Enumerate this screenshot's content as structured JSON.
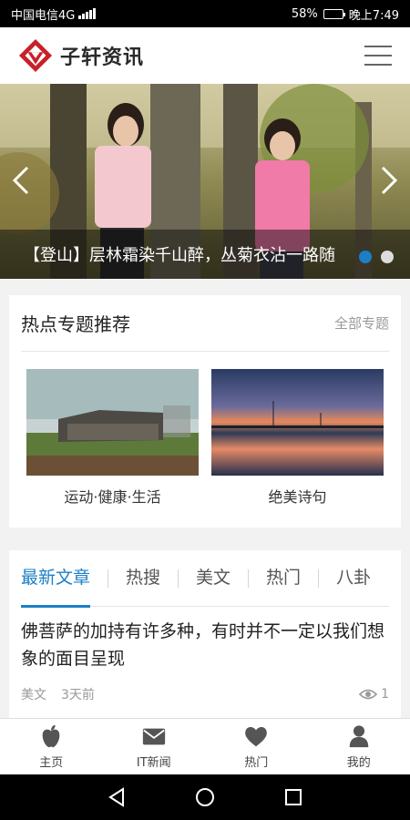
{
  "status_bar": {
    "carrier": "中国电信4G",
    "battery": "58%",
    "time": "晚上7:49"
  },
  "header": {
    "app_name": "子轩资讯",
    "logo_icon": "diamond-logo-icon",
    "menu_icon": "hamburger-menu-icon"
  },
  "banner": {
    "caption": "【登山】层林霜染千山醉，丛菊衣沾一路随",
    "slide_count": 2,
    "active_slide": 1,
    "prev_icon": "chevron-left-icon",
    "next_icon": "chevron-right-icon"
  },
  "topics": {
    "title": "热点专题推荐",
    "all_link": "全部专题",
    "items": [
      {
        "name": "运动·健康·生活"
      },
      {
        "name": "绝美诗句"
      }
    ]
  },
  "articles": {
    "tabs": [
      {
        "label": "最新文章",
        "active": true
      },
      {
        "label": "热搜",
        "active": false
      },
      {
        "label": "美文",
        "active": false
      },
      {
        "label": "热门",
        "active": false
      },
      {
        "label": "八卦",
        "active": false
      }
    ],
    "items": [
      {
        "title": "佛菩萨的加持有许多种，有时并不一定以我们想象的面目呈现",
        "category": "美文",
        "time": "3天前",
        "views": "1"
      }
    ]
  },
  "bottom_nav": [
    {
      "label": "主页",
      "icon": "apple-icon"
    },
    {
      "label": "IT新闻",
      "icon": "mail-icon"
    },
    {
      "label": "热门",
      "icon": "heart-icon"
    },
    {
      "label": "我的",
      "icon": "user-icon"
    }
  ],
  "colors": {
    "accent": "#1c7fc6",
    "logo_red": "#c8202a"
  }
}
